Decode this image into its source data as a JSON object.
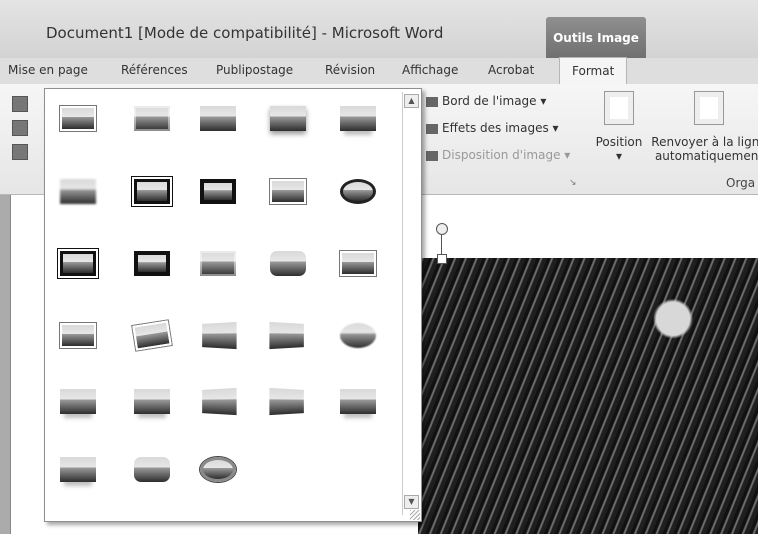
{
  "window": {
    "title": "Document1 [Mode de compatibilité] - Microsoft Word",
    "context_tab": "Outils Image"
  },
  "ribbon_tabs": {
    "page_layout": "Mise en page",
    "references": "Références",
    "mailings": "Publipostage",
    "review": "Révision",
    "view": "Affichage",
    "acrobat": "Acrobat",
    "format": "Format"
  },
  "picture_styles": [
    {
      "name": "simple-frame-white"
    },
    {
      "name": "bevel-rectangle"
    },
    {
      "name": "metal-frame"
    },
    {
      "name": "drop-shadow-rectangle"
    },
    {
      "name": "reflected-rounded-rectangle"
    },
    {
      "name": "soft-edge-rectangle"
    },
    {
      "name": "double-frame-black"
    },
    {
      "name": "thick-matte-black"
    },
    {
      "name": "simple-frame-black"
    },
    {
      "name": "oval-black"
    },
    {
      "name": "compound-frame-black"
    },
    {
      "name": "center-shadow-rectangle"
    },
    {
      "name": "rounded-diagonal-corner-white"
    },
    {
      "name": "snip-diagonal-corner-white"
    },
    {
      "name": "moderate-frame-white"
    },
    {
      "name": "rotated-white"
    },
    {
      "name": "perspective-shadow-white"
    },
    {
      "name": "relaxed-perspective-white"
    },
    {
      "name": "soft-edge-oval"
    },
    {
      "name": "bevel-rounded-rectangle"
    },
    {
      "name": "bevel-perspective"
    },
    {
      "name": "reflected-bevel-white"
    },
    {
      "name": "bevel-perspective-left-white"
    },
    {
      "name": "reflected-bevel-black"
    },
    {
      "name": "reflected-rounded"
    },
    {
      "name": "metal-rounded-rectangle"
    },
    {
      "name": "metal-oval"
    }
  ],
  "commands": {
    "border": "Bord de l'image",
    "effects": "Effets des images",
    "layout": "Disposition d'image"
  },
  "arrange": {
    "position": "Position",
    "wrap_line1": "Renvoyer à la ligne",
    "wrap_line2": "automatiquement",
    "group_label": "Orga"
  }
}
